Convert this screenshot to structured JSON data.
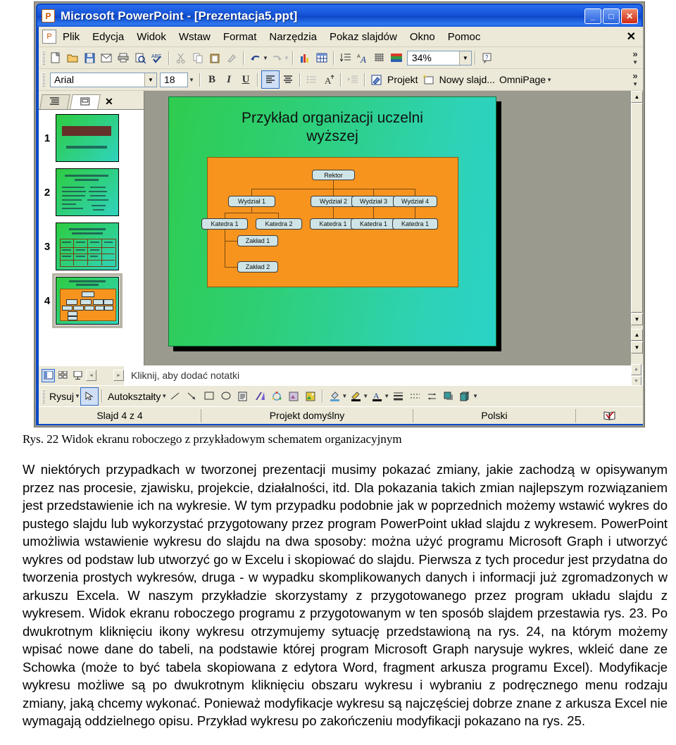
{
  "window": {
    "title": "Microsoft PowerPoint - [Prezentacja5.ppt]",
    "app_icon": "powerpoint-icon",
    "minimize_label": "_",
    "maximize_label": "□",
    "close_label": "✕"
  },
  "menubar": {
    "doc_close_label": "✕",
    "items": [
      {
        "label": "Plik",
        "accel": "P"
      },
      {
        "label": "Edycja",
        "accel": "E"
      },
      {
        "label": "Widok",
        "accel": "W"
      },
      {
        "label": "Wstaw",
        "accel": "s"
      },
      {
        "label": "Format",
        "accel": "F"
      },
      {
        "label": "Narzędzia",
        "accel": "N"
      },
      {
        "label": "Pokaz slajdów",
        "accel": "k"
      },
      {
        "label": "Okno",
        "accel": "O"
      },
      {
        "label": "Pomoc",
        "accel": "c"
      }
    ]
  },
  "standard_toolbar": {
    "overflow_label": "»",
    "zoom_value": "34%",
    "buttons": [
      {
        "name": "new-icon",
        "glyph": "☐"
      },
      {
        "name": "open-icon",
        "glyph": "📂"
      },
      {
        "name": "save-icon",
        "glyph": "💾"
      },
      {
        "name": "mail-icon",
        "glyph": "✉"
      },
      {
        "name": "print-icon",
        "glyph": "⎙"
      },
      {
        "name": "print-preview-icon",
        "glyph": "🔍"
      },
      {
        "name": "spellcheck-icon",
        "glyph": "✓"
      },
      {
        "name": "cut-icon",
        "glyph": "✂"
      },
      {
        "name": "copy-icon",
        "glyph": "⧉"
      },
      {
        "name": "paste-icon",
        "glyph": "📋"
      },
      {
        "name": "format-painter-icon",
        "glyph": "🖌"
      },
      {
        "name": "undo-icon",
        "glyph": "↶"
      },
      {
        "name": "redo-icon",
        "glyph": "↷"
      },
      {
        "name": "insert-chart-icon",
        "glyph": "📊"
      },
      {
        "name": "insert-table-icon",
        "glyph": "▦"
      },
      {
        "name": "line-spacing-icon",
        "glyph": "↕"
      },
      {
        "name": "font-color-icon",
        "glyph": "A"
      },
      {
        "name": "grid-icon",
        "glyph": "⌗"
      },
      {
        "name": "color-scheme-icon",
        "glyph": "■"
      },
      {
        "name": "help-icon",
        "glyph": "?"
      }
    ]
  },
  "formatting_toolbar": {
    "font_name": "Arial",
    "font_size": "18",
    "bold_label": "B",
    "italic_label": "I",
    "underline_label": "U",
    "align_left_icon": "align-left-icon",
    "align_center_icon": "align-center-icon",
    "bullets_icon": "bullets-icon",
    "font_grow_label": "A",
    "indent_icon": "indent-icon",
    "design_label": "Projekt",
    "new_slide_label": "Nowy slajd...",
    "omnipage_label": "OmniPage",
    "overflow_label": "»"
  },
  "outline_pane": {
    "tab_outline_icon": "outline-tab-icon",
    "tab_slides_icon": "slides-tab-icon",
    "close_label": "✕",
    "thumbnails": [
      {
        "number": "1",
        "selected": false
      },
      {
        "number": "2",
        "selected": false
      },
      {
        "number": "3",
        "selected": false
      },
      {
        "number": "4",
        "selected": true
      }
    ]
  },
  "slide": {
    "title_line1": "Przykład organizacji uczelni",
    "title_line2": "wyższej",
    "org_chart": {
      "root": "Rektor",
      "level2": [
        "Wydział 1",
        "Wydział 2",
        "Wydział 3",
        "Wydział 4"
      ],
      "level3": [
        "Katedra 1",
        "Katedra 2",
        "Katedra 1",
        "Katedra 1",
        "Katedra 1"
      ],
      "level4": [
        "Zakład 1",
        "Zakład 2"
      ]
    }
  },
  "notes_pane": {
    "placeholder": "Kliknij, aby dodać notatki",
    "view_normal_icon": "view-normal-icon",
    "view_sorter_icon": "view-slide-sorter-icon",
    "view_show_icon": "view-slide-show-icon",
    "prev_label": "◄",
    "next_label": "►"
  },
  "drawing_toolbar": {
    "draw_label": "Rysuj",
    "select_icon": "select-arrow-icon",
    "autoshapes_label": "Autokształty",
    "buttons": [
      {
        "name": "line-icon",
        "glyph": "╲"
      },
      {
        "name": "arrow-icon",
        "glyph": "↘"
      },
      {
        "name": "rectangle-icon",
        "glyph": "▭"
      },
      {
        "name": "oval-icon",
        "glyph": "◯"
      },
      {
        "name": "textbox-icon",
        "glyph": "▤"
      },
      {
        "name": "wordart-icon",
        "glyph": "◤"
      },
      {
        "name": "diagram-icon",
        "glyph": "⚬"
      },
      {
        "name": "clipart-icon",
        "glyph": "⚘"
      },
      {
        "name": "picture-icon",
        "glyph": "🖼"
      },
      {
        "name": "fill-color-icon",
        "glyph": "🪣"
      },
      {
        "name": "line-color-icon",
        "glyph": "🖊"
      },
      {
        "name": "font-color-icon",
        "glyph": "A"
      },
      {
        "name": "line-style-icon",
        "glyph": "≡"
      },
      {
        "name": "dash-style-icon",
        "glyph": "┈"
      },
      {
        "name": "arrow-style-icon",
        "glyph": "⇄"
      },
      {
        "name": "shadow-style-icon",
        "glyph": "■"
      },
      {
        "name": "3d-style-icon",
        "glyph": "⬟"
      }
    ]
  },
  "status_bar": {
    "slide_counter": "Slajd 4 z 4",
    "design_name": "Projekt domyślny",
    "language": "Polski",
    "spellcheck_icon": "spellcheck-status-icon"
  },
  "document": {
    "figure_caption": "Rys. 22 Widok ekranu roboczego z przykładowym schematem organizacyjnym",
    "paragraph": "W niektórych przypadkach w tworzonej prezentacji musimy pokazać zmiany, jakie zachodzą w opisywanym przez nas procesie, zjawisku, projekcie, działalności, itd. Dla pokazania takich zmian najlepszym rozwiązaniem jest przedstawienie ich na wykresie. W tym przypadku podobnie jak w poprzednich możemy wstawić wykres do pustego slajdu lub wykorzystać przygotowany przez program PowerPoint układ slajdu z wykresem. PowerPoint umożliwia wstawienie wykresu do slajdu na dwa sposoby: można użyć programu Microsoft Graph i utworzyć wykres od podstaw lub utworzyć go w Excelu i skopiować do slajdu. Pierwsza z tych procedur jest przydatna do tworzenia prostych wykresów, druga - w wypadku skomplikowanych danych i informacji już zgromadzonych w arkuszu Excela. W naszym przykładzie skorzystamy z przygotowanego przez program układu slajdu z wykresem. Widok ekranu roboczego programu z przygotowanym w ten sposób slajdem przestawia rys. 23. Po dwukrotnym kliknięciu ikony wykresu otrzymujemy sytuację przedstawioną na rys. 24, na którym możemy wpisać nowe dane do tabeli, na podstawie której program Microsoft Graph narysuje wykres, wkleić dane ze Schowka (może to być tabela skopiowana z edytora Word, fragment arkusza programu Excel). Modyfikacje wykresu możliwe są po dwukrotnym kliknięciu obszaru wykresu i wybraniu z podręcznego menu rodzaju zmiany, jaką chcemy wykonać. Ponieważ modyfikacje wykresu są najczęściej dobrze znane z arkusza Excel nie wymagają oddzielnego opisu. Przykład wykresu po zakończeniu modyfikacji pokazano na rys. 25."
  },
  "colors": {
    "titlebar_blue": "#0d47c8",
    "chrome": "#ece9d8",
    "slide_green": "#2ecf76",
    "chart_orange": "#f7941e",
    "node_fill": "#cfe4e6"
  }
}
